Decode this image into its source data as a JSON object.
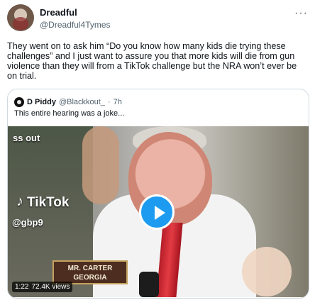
{
  "author": {
    "name": "Dreadful",
    "handle": "@Dreadful4Tymes"
  },
  "tweet": {
    "text": "They went on to ask him “Do you know how many kids die trying these challenges” and I just want to assure you that more kids will die from gun violence than they will from a TikTok challenge but the NRA won’t ever be on trial."
  },
  "quote": {
    "name": "D Piddy",
    "handle": "@Blackkout_",
    "time": "7h",
    "text": "This entire hearing was a joke..."
  },
  "video": {
    "overlay_top": "ss out",
    "tiktok_label": "TikTok",
    "tiktok_handle": "@gbp9",
    "nameplate_line1": "MR. CARTER",
    "nameplate_line2": "GEORGIA",
    "duration": "1:22",
    "views": "72.4K views"
  },
  "ui": {
    "more_icon": "more-options-icon",
    "play_icon": "play-icon",
    "accent": "#1d9bf0"
  }
}
